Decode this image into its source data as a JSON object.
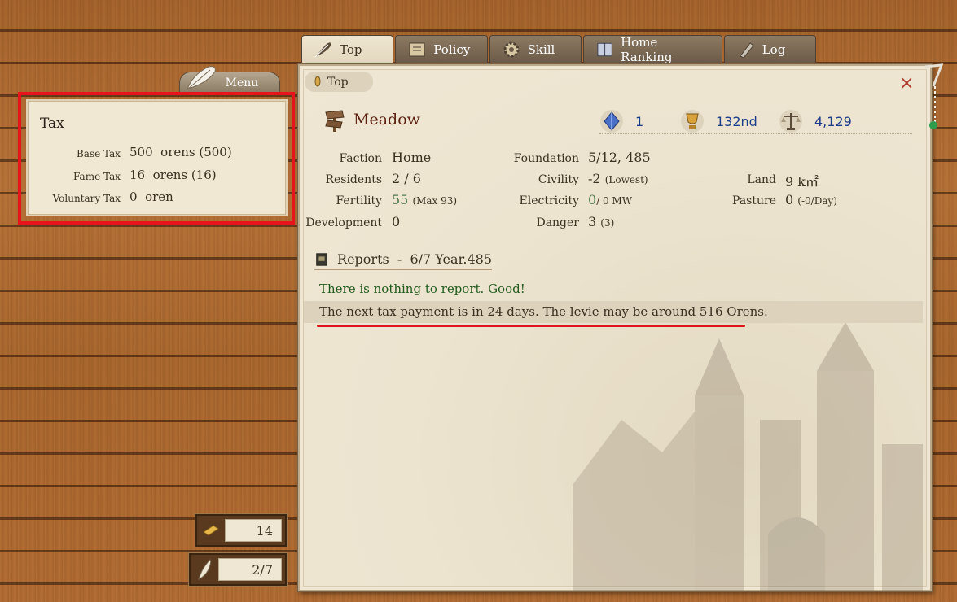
{
  "tabs": [
    {
      "label": "Top",
      "icon": "quill-icon",
      "active": true
    },
    {
      "label": "Policy",
      "icon": "scroll-icon",
      "active": false
    },
    {
      "label": "Skill",
      "icon": "gear-icon",
      "active": false
    },
    {
      "label": "Home Ranking",
      "icon": "book-icon",
      "active": false
    },
    {
      "label": "Log",
      "icon": "document-icon",
      "active": false
    }
  ],
  "breadcrumb": "Top",
  "close_symbol": "×",
  "home": {
    "name": "Meadow",
    "stats": {
      "crystal": "1",
      "rank": "132nd",
      "balance": "4,129"
    },
    "fields": {
      "faction_label": "Faction",
      "faction_value": "Home",
      "residents_label": "Residents",
      "residents_value": "2 / 6",
      "fertility_label": "Fertility",
      "fertility_value": "55",
      "fertility_note": "(Max 93)",
      "development_label": "Development",
      "development_value": "0",
      "foundation_label": "Foundation",
      "foundation_value": "5/12, 485",
      "civility_label": "Civility",
      "civility_value": "-2",
      "civility_note": "(Lowest)",
      "electricity_label": "Electricity",
      "electricity_value": "0",
      "electricity_rest": "/ 0 MW",
      "danger_label": "Danger",
      "danger_value": "3",
      "danger_note": "(3)",
      "land_label": "Land",
      "land_value": "9 k㎡",
      "pasture_label": "Pasture",
      "pasture_value": "0",
      "pasture_note": "(-0/Day)"
    }
  },
  "reports": {
    "title": "Reports  -  6/7 Year.485",
    "good_message": "There is nothing to report. Good!",
    "tax_message": "The next tax payment is in 24 days. The levie may be around 516 Orens."
  },
  "menu_label": "Menu",
  "tax": {
    "title": "Tax",
    "base_label": "Base Tax",
    "base_value": "500  orens (500)",
    "fame_label": "Fame Tax",
    "fame_value": "16  orens (16)",
    "voluntary_label": "Voluntary Tax",
    "voluntary_value": "0  oren"
  },
  "counters": {
    "tickets": "14",
    "date": "2/7"
  },
  "colors": {
    "highlight_box": "#e8141c",
    "stat_text": "#1c3d8a",
    "good_text": "#1f5a1c"
  }
}
